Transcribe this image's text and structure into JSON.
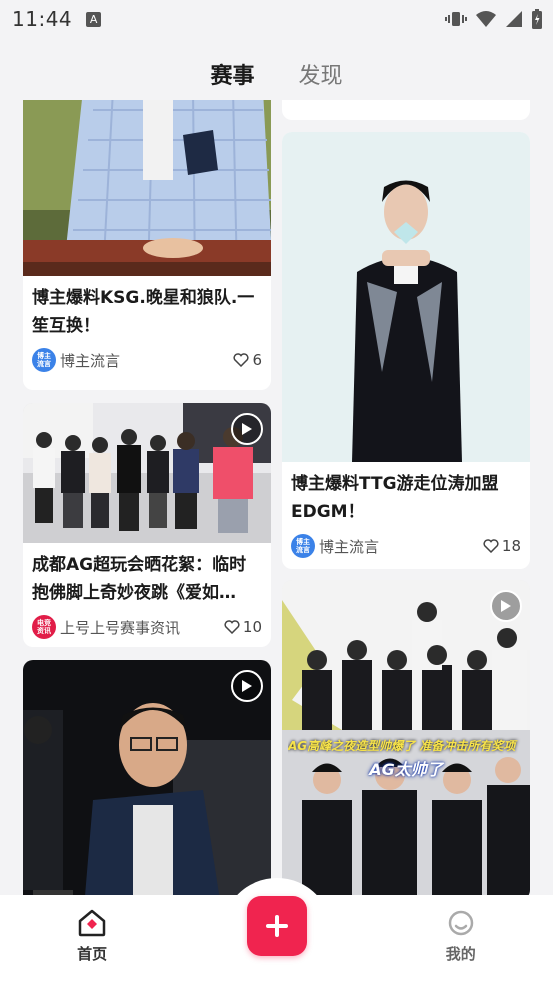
{
  "status_bar": {
    "time": "11:44",
    "notification_icon": "A"
  },
  "tabs": [
    {
      "label": "赛事",
      "active": true
    },
    {
      "label": "发现",
      "active": false
    }
  ],
  "feed": {
    "left": [
      {
        "title": "博主爆料KSG.晚星和狼队.一笙互换！",
        "author": "博主流言",
        "avatar_text": "博主\n流言",
        "avatar_color": "#3b82e8",
        "likes": "6",
        "has_video": false
      },
      {
        "title": "成都AG超玩会晒花絮：临时抱佛脚上奇妙夜跳《爱如…",
        "author": "上号上号赛事资讯",
        "avatar_text": "电竞\n资讯",
        "avatar_color": "#e11d48",
        "likes": "10",
        "has_video": true
      },
      {
        "title": "",
        "author": "",
        "likes": "",
        "has_video": true
      }
    ],
    "right": [
      {
        "title": "博主爆料TTG游走位涛加盟EDGM！",
        "author": "博主流言",
        "avatar_text": "博主\n流言",
        "avatar_color": "#3b82e8",
        "likes": "18",
        "has_video": false
      },
      {
        "title": "",
        "author": "",
        "likes": "",
        "has_video": true,
        "overlay_1": "AG高峰之夜造型帅爆了 准备冲击所有奖项",
        "overlay_2": "AG太帅了"
      }
    ]
  },
  "bottom_nav": {
    "home_label": "首页",
    "profile_label": "我的",
    "accent": "#f0244f"
  }
}
